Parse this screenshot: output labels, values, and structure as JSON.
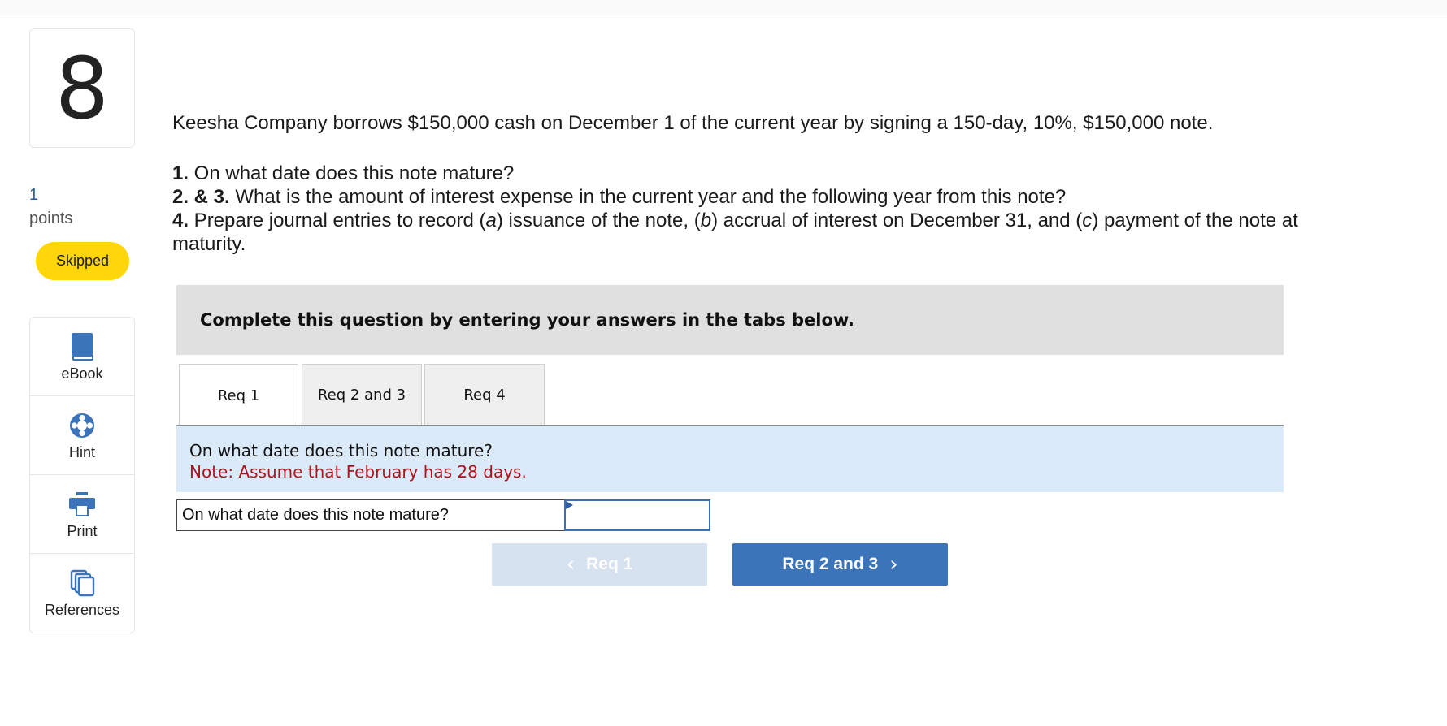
{
  "question": {
    "number": "8",
    "points_value": "1",
    "points_label": "points",
    "status": "Skipped"
  },
  "tools": [
    {
      "label": "eBook",
      "icon": "book-icon"
    },
    {
      "label": "Hint",
      "icon": "lifebuoy-icon"
    },
    {
      "label": "Print",
      "icon": "printer-icon"
    },
    {
      "label": "References",
      "icon": "copy-documents-icon"
    }
  ],
  "problem": {
    "intro": "Keesha Company borrows $150,000 cash on December 1 of the current year by signing a 150-day, 10%, $150,000 note.",
    "req1_num": "1.",
    "req1_text": " On what date does this note mature?",
    "req23_num": "2. & 3.",
    "req23_text": " What is the amount of interest expense in the current year and the following year from this note?",
    "req4_num": "4.",
    "req4_text_a": " Prepare journal entries to record (",
    "req4_a": "a",
    "req4_text_b": ") issuance of the note, (",
    "req4_b": "b",
    "req4_text_c": ") accrual of interest on December 31, and (",
    "req4_c": "c",
    "req4_text_d": ") payment of the note at maturity."
  },
  "banner": "Complete this question by entering your answers in the tabs below.",
  "tabs": [
    "Req 1",
    "Req 2 and 3",
    "Req 4"
  ],
  "active_tab": "Req 1",
  "instructions": {
    "question": "On what date does this note mature?",
    "note": "Note: Assume that February has 28 days."
  },
  "answer": {
    "label": "On what date does this note mature?",
    "value": ""
  },
  "nav": {
    "prev_label": "Req 1",
    "next_label": "Req 2 and 3"
  },
  "colors": {
    "skipped_badge": "#ffd60a",
    "tool_icon": "#3b74b9",
    "next_button": "#3b74b9",
    "prev_button_disabled": "#d6e2f0",
    "instruction_bg": "#dbeaf8",
    "note_text": "#b0131b"
  }
}
